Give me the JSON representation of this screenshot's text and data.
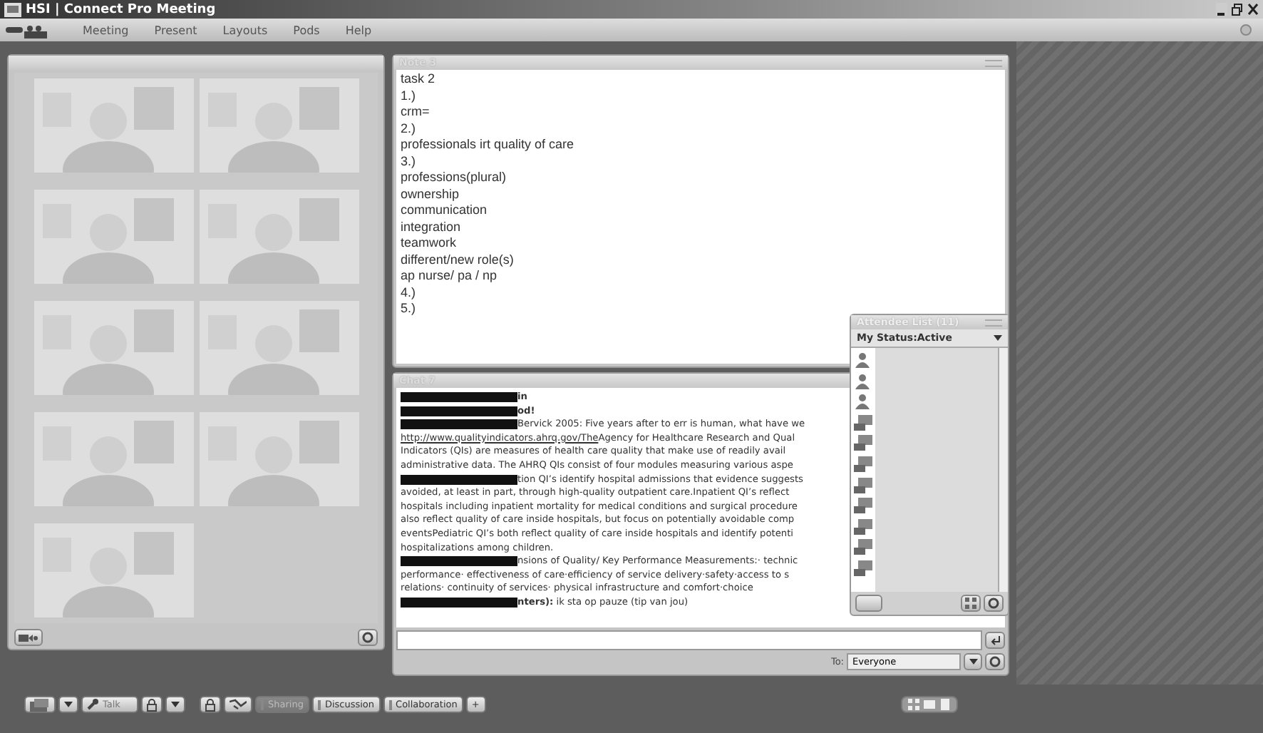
{
  "window": {
    "title": "HSI | Connect Pro Meeting"
  },
  "menu": [
    "Meeting",
    "Present",
    "Layouts",
    "Pods",
    "Help"
  ],
  "note": {
    "title": "Note 3",
    "lines": [
      "task 2",
      "1.)",
      "crm=",
      "2.)",
      "professionals irt quality of care",
      "3.)",
      "professions(plural)",
      "ownership",
      "communication",
      "integration",
      "teamwork",
      "different/new role(s)",
      "ap nurse/ pa / np",
      "4.)",
      "5.)"
    ]
  },
  "chat": {
    "title": "Chat 7",
    "messages": [
      {
        "redacted": true,
        "text": "**in**"
      },
      {
        "redacted": true,
        "text": "**od!**"
      },
      {
        "redacted": true,
        "text": "Bervick 2005: Five years after to err is human, what have we"
      },
      {
        "redacted": false,
        "link": "http://www.qualityindicators.ahrq.gov/The",
        "text": " Agency for Healthcare Research and Qual"
      },
      {
        "redacted": false,
        "text": "Indicators (QIs) are measures of health care quality that make use of readily avail"
      },
      {
        "redacted": false,
        "text": "administrative data. The AHRQ QIs consist of four modules measuring various aspe"
      },
      {
        "redacted": true,
        "text": "tion QI’s identify hospital admissions that evidence suggests"
      },
      {
        "redacted": false,
        "text": "avoided, at least in part, through high-quality outpatient care.Inpatient QI’s reflect"
      },
      {
        "redacted": false,
        "text": "hospitals including inpatient mortality for medical conditions and surgical procedure"
      },
      {
        "redacted": false,
        "text": "also reflect quality of care inside hospitals, but focus on potentially avoidable comp"
      },
      {
        "redacted": false,
        "text": "eventsPediatric QI’s both reflect quality of care inside hospitals and identify potenti"
      },
      {
        "redacted": false,
        "text": "hospitalizations among children."
      },
      {
        "redacted": true,
        "text": "nsions of Quality/ Key Performance Measurements:·   technic"
      },
      {
        "redacted": false,
        "text": "performance·   effectiveness of care·efficiency of service delivery·safety·access to s"
      },
      {
        "redacted": false,
        "text": "relations·   continuity of services·     physical infrastructure and comfort·choice"
      },
      {
        "redacted": true,
        "text": "**nters):** ik sta op pauze (tip van jou)"
      }
    ],
    "to_label": "To:",
    "recipient": "Everyone"
  },
  "attendees": {
    "title": "Attendee List (11)",
    "status": "My Status:Active",
    "list": [
      {
        "kind": "host"
      },
      {
        "kind": "host"
      },
      {
        "kind": "host"
      },
      {
        "kind": "participant"
      },
      {
        "kind": "participant"
      },
      {
        "kind": "participant"
      },
      {
        "kind": "participant"
      },
      {
        "kind": "participant"
      },
      {
        "kind": "participant"
      },
      {
        "kind": "participant"
      },
      {
        "kind": "participant"
      }
    ]
  },
  "toolbar": {
    "talk": {
      "label": "Talk",
      "disabled": true
    },
    "layouts": [
      {
        "label": "Sharing",
        "selected": true
      },
      {
        "label": "Discussion",
        "selected": false
      },
      {
        "label": "Collaboration",
        "selected": false
      }
    ],
    "add": "+"
  }
}
